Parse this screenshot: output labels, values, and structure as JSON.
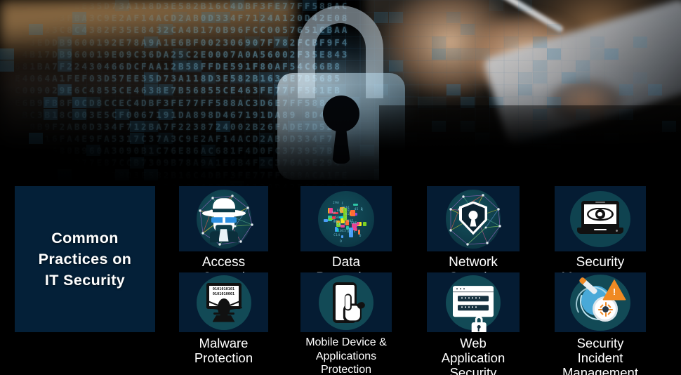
{
  "hero": {
    "alt": "padlock-over-hex-code-with-person-using-tablet",
    "hex_rows": [
      "A1FEF03D57EE35D73A118D3E582B16C4DBF3FE77FF588AC",
      "0D42E086BD916D93FBA3C9E2AF14ACD2AB0D334F7124A12",
      "FCC0057651CBAAD4D65A23C8C4382F35E8432CA4B170B96",
      "F002306907F782FCBF9F4AD9B3EDDB9600192E78A9A1E6B",
      "36DA25C2E0007A0A56002F35E8432CA4B17DB960019E09C",
      "430466DCFAA12B58FFDE591F80AF54C66B8AC681BA7F22",
      "064A1FEF03D57EE35D73A118D3E582B1638E7B56855CE4",
      "1EB45C009029E6C4855CE4638E7B56855CE463FE77FF58",
      "7FF588AC3D6E6B9FB8F0CD8CCEC4DBF3FE77FF588AC3D6E",
      "67191DA89 8D4933898BC3B18C003E5CF0067191DA898D4",
      "BA7F2238724002B26FADE7D52EA2B0B9F2AB0D334F712",
      "5317C37A3C9E2AF14ACD2AB0D334F7124A12916FA4E9FA",
      "80B960A3090B1C76E86AC681F4D0FC373957BA9A165166",
      "0D6EAD575277E87CCB7309B78A9A1E6B4F2C376A3E2947"
    ]
  },
  "title_panel": {
    "line1": "Common",
    "line2": "Practices on",
    "line3": "IT Security"
  },
  "colors": {
    "panel_navy": "#042038",
    "card_navy": "#051c33",
    "disc_teal": "#124a56",
    "accent_orange": "#f08a23",
    "accent_blue": "#49a9d8",
    "label_white": "#ffffff"
  },
  "cards": [
    {
      "label": "Access Control",
      "icon": "spy-mesh-icon",
      "row": 1
    },
    {
      "label": "Data Protection",
      "icon": "data-blocks-icon",
      "row": 1
    },
    {
      "label": "Network Security",
      "icon": "shield-mesh-icon",
      "row": 1
    },
    {
      "label": "Security Management",
      "icon": "laptop-eye-icon",
      "row": 1
    },
    {
      "label": "Malware Protection",
      "icon": "monitor-bug-icon",
      "row": 2
    },
    {
      "label": "Mobile Device &\nApplications Protection",
      "icon": "phone-touch-icon",
      "row": 2
    },
    {
      "label": "Web Application\nSecurity",
      "icon": "browser-padlock-icon",
      "row": 2
    },
    {
      "label": "Security Incident\nManagement",
      "icon": "magnifier-virus-alert-icon",
      "row": 2
    }
  ],
  "data_protection_labels": [
    "X",
    "D5 E C",
    "45 E",
    "D",
    "C14",
    "10E5",
    "D",
    "50E",
    "S",
    "C",
    "B",
    "2",
    "A1",
    "9A",
    "50 E C",
    "D5",
    "E",
    "29A1",
    "29A",
    "0E5 C0",
    "50E",
    "A",
    "S",
    "S"
  ],
  "malware_binary": [
    "0101010101",
    "0101010001"
  ],
  "incident_warning_glyph": "!"
}
